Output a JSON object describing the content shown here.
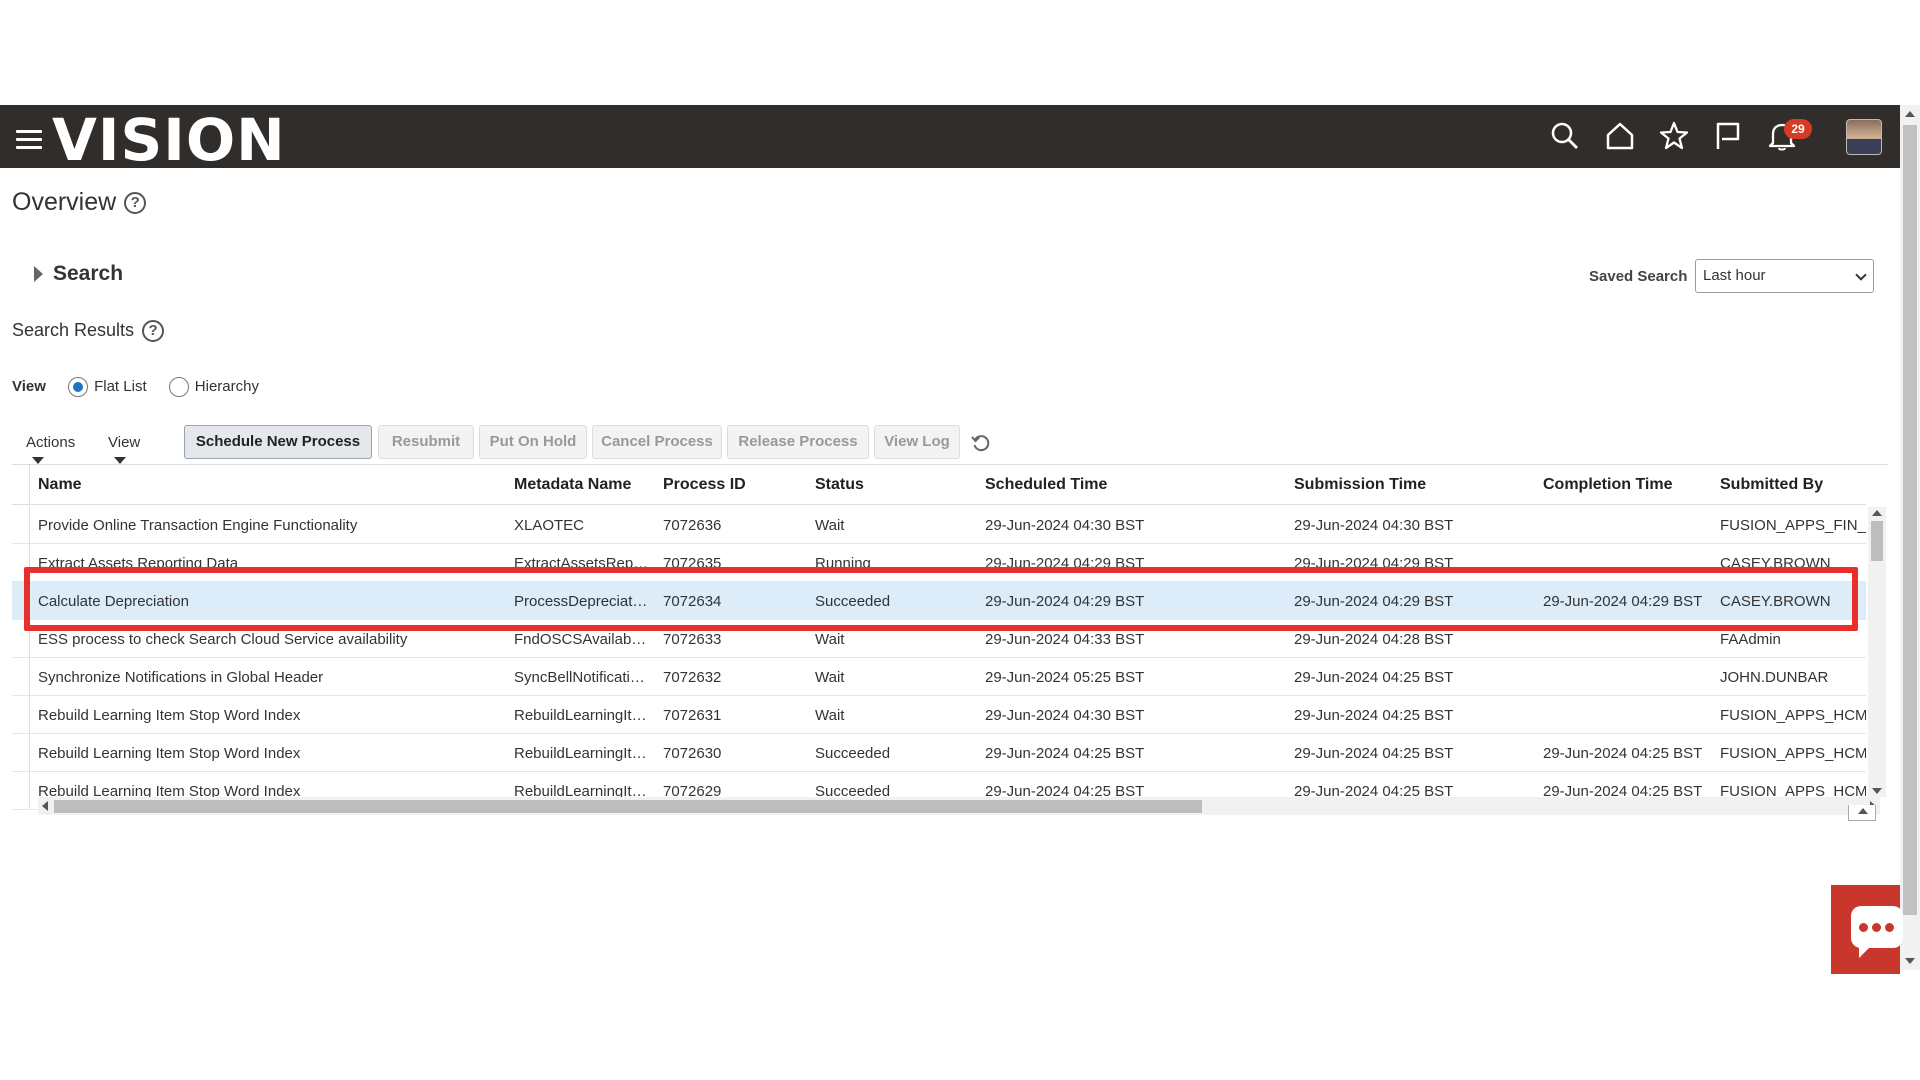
{
  "header": {
    "logo": "VISION",
    "notification_count": "29",
    "icons": [
      "search-icon",
      "home-icon",
      "star-icon",
      "flag-icon",
      "bell-icon"
    ]
  },
  "page": {
    "title": "Overview",
    "help": "?"
  },
  "search": {
    "label": "Search",
    "saved_search_label": "Saved Search",
    "saved_search_value": "Last hour"
  },
  "results": {
    "title": "Search Results",
    "help": "?"
  },
  "view": {
    "label": "View",
    "options": [
      "Flat List",
      "Hierarchy"
    ],
    "selected": "Flat List"
  },
  "toolbar": {
    "actions": "Actions",
    "view": "View",
    "buttons": [
      "Schedule New Process",
      "Resubmit",
      "Put On Hold",
      "Cancel Process",
      "Release Process",
      "View Log"
    ]
  },
  "table": {
    "columns": [
      "Name",
      "Metadata Name",
      "Process ID",
      "Status",
      "Scheduled Time",
      "Submission Time",
      "Completion Time",
      "Submitted By"
    ],
    "rows": [
      [
        "Provide Online Transaction Engine Functionality",
        "XLAOTEC",
        "7072636",
        "Wait",
        "29-Jun-2024 04:30 BST",
        "29-Jun-2024 04:30 BST",
        "",
        "FUSION_APPS_FIN_"
      ],
      [
        "Extract Assets Reporting Data",
        "ExtractAssetsRep…",
        "7072635",
        "Running",
        "29-Jun-2024 04:29 BST",
        "29-Jun-2024 04:29 BST",
        "",
        "CASEY.BROWN"
      ],
      [
        "Calculate Depreciation",
        "ProcessDepreciat…",
        "7072634",
        "Succeeded",
        "29-Jun-2024 04:29 BST",
        "29-Jun-2024 04:29 BST",
        "29-Jun-2024 04:29 BST",
        "CASEY.BROWN"
      ],
      [
        "ESS process to check Search Cloud Service availability",
        "FndOSCSAvailab…",
        "7072633",
        "Wait",
        "29-Jun-2024 04:33 BST",
        "29-Jun-2024 04:28 BST",
        "",
        "FAAdmin"
      ],
      [
        "Synchronize Notifications in Global Header",
        "SyncBellNotificati…",
        "7072632",
        "Wait",
        "29-Jun-2024 05:25 BST",
        "29-Jun-2024 04:25 BST",
        "",
        "JOHN.DUNBAR"
      ],
      [
        "Rebuild Learning Item Stop Word Index",
        "RebuildLearningIt…",
        "7072631",
        "Wait",
        "29-Jun-2024 04:30 BST",
        "29-Jun-2024 04:25 BST",
        "",
        "FUSION_APPS_HCM"
      ],
      [
        "Rebuild Learning Item Stop Word Index",
        "RebuildLearningIt…",
        "7072630",
        "Succeeded",
        "29-Jun-2024 04:25 BST",
        "29-Jun-2024 04:25 BST",
        "29-Jun-2024 04:25 BST",
        "FUSION_APPS_HCM"
      ],
      [
        "Rebuild Learning Item Stop Word Index",
        "RebuildLearningIt…",
        "7072629",
        "Succeeded",
        "29-Jun-2024 04:25 BST",
        "29-Jun-2024 04:25 BST",
        "29-Jun-2024 04:25 BST",
        "FUSION_APPS_HCM"
      ]
    ],
    "selected_row": 2
  },
  "colors": {
    "header_bg": "#312d2a",
    "selected_row": "#dcecf9",
    "highlight": "#e8302b",
    "chat_button": "#c9362c"
  }
}
